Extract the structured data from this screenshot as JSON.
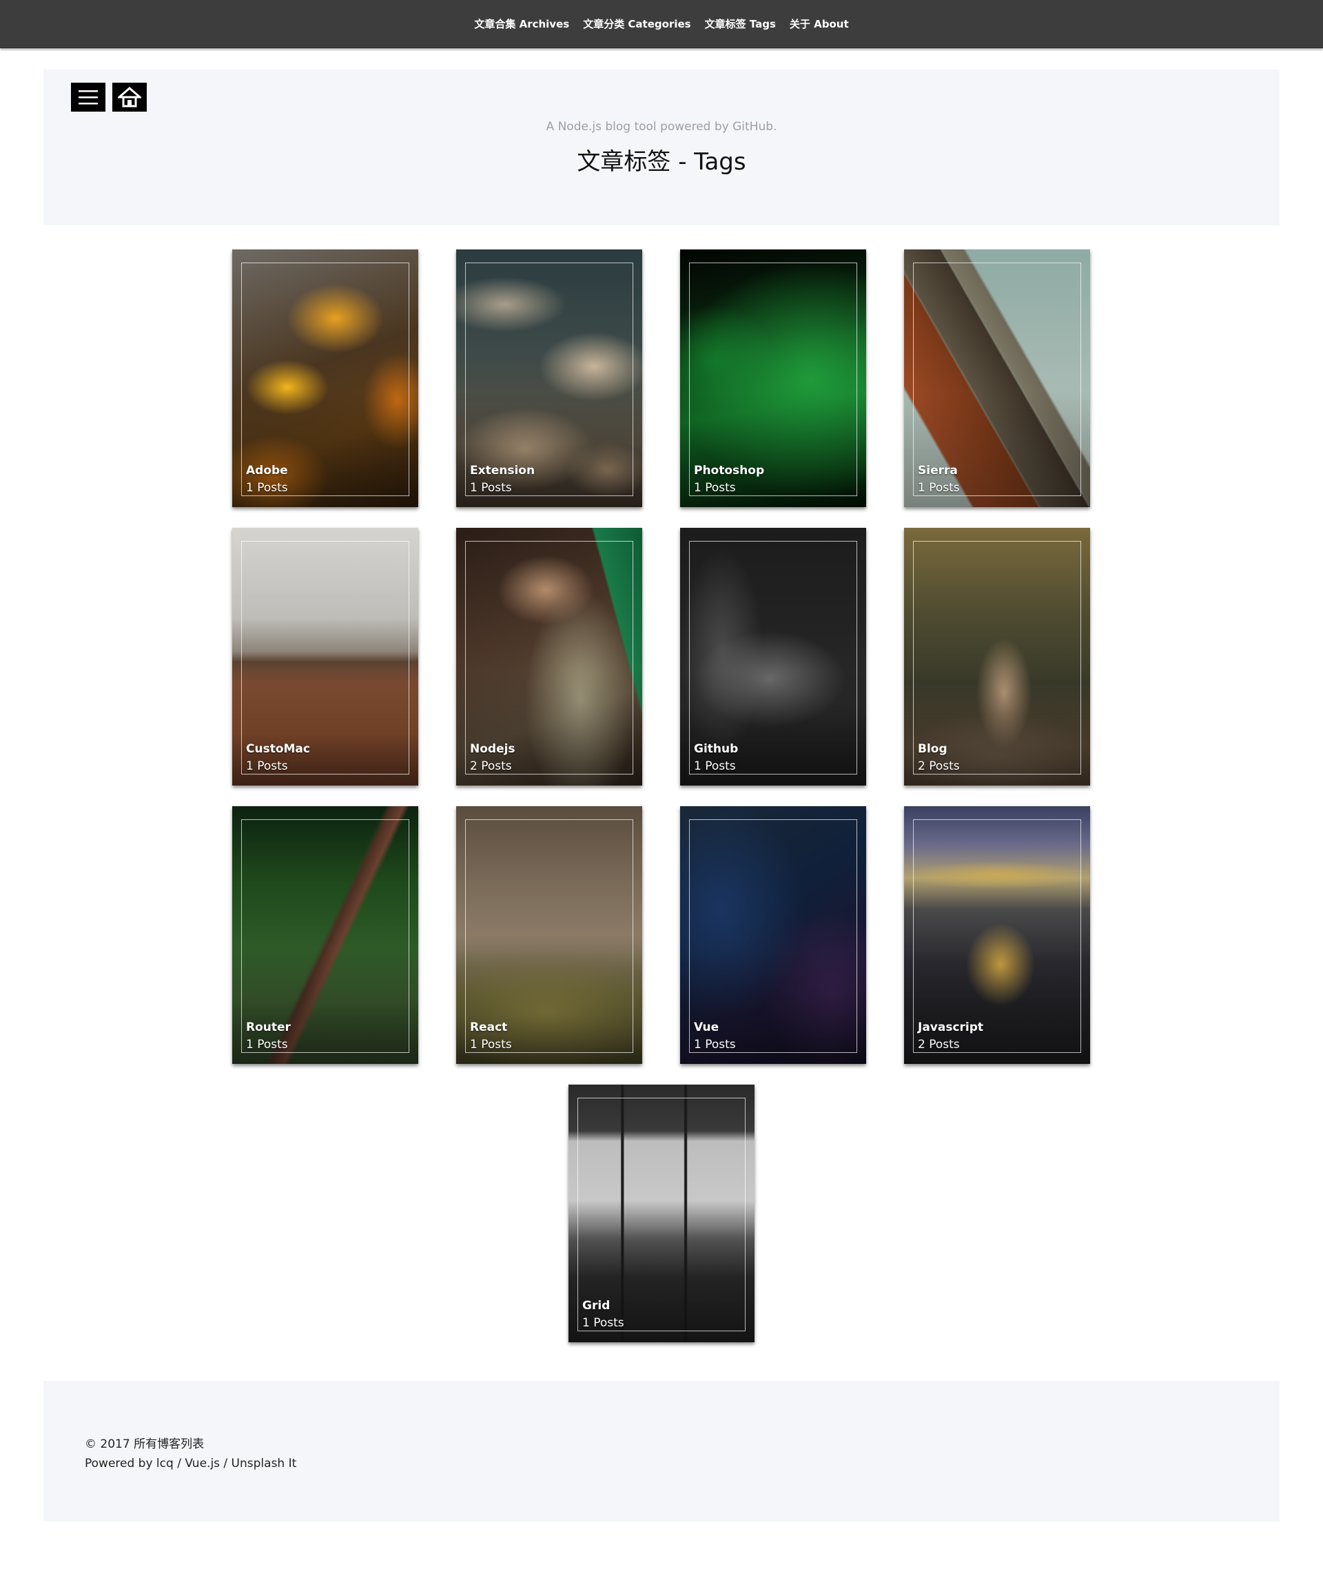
{
  "nav": {
    "items": [
      {
        "label": "文章合集 Archives"
      },
      {
        "label": "文章分类 Categories"
      },
      {
        "label": "文章标签 Tags"
      },
      {
        "label": "关于 About"
      }
    ]
  },
  "header": {
    "menu_icon": "menu-icon",
    "home_icon": "home-icon",
    "subtitle": "A Node.js blog tool powered by GitHub.",
    "title": "文章标签 - Tags"
  },
  "tags": [
    {
      "name": "Adobe",
      "count": "1 Posts"
    },
    {
      "name": "Extension",
      "count": "1 Posts"
    },
    {
      "name": "Photoshop",
      "count": "1 Posts"
    },
    {
      "name": "Sierra",
      "count": "1 Posts"
    },
    {
      "name": "CustoMac",
      "count": "1 Posts"
    },
    {
      "name": "Nodejs",
      "count": "2 Posts"
    },
    {
      "name": "Github",
      "count": "1 Posts"
    },
    {
      "name": "Blog",
      "count": "2 Posts"
    },
    {
      "name": "Router",
      "count": "1 Posts"
    },
    {
      "name": "React",
      "count": "1 Posts"
    },
    {
      "name": "Vue",
      "count": "1 Posts"
    },
    {
      "name": "Javascript",
      "count": "2 Posts"
    },
    {
      "name": "Grid",
      "count": "1 Posts"
    }
  ],
  "footer": {
    "copyright": "© 2017 所有博客列表",
    "powered": "Powered by lcq / Vue.js / Unsplash It"
  },
  "colors": {
    "nav_bg": "#3d3d3d",
    "panel_bg": "#f4f6f9",
    "icon_button_bg": "#000000"
  }
}
